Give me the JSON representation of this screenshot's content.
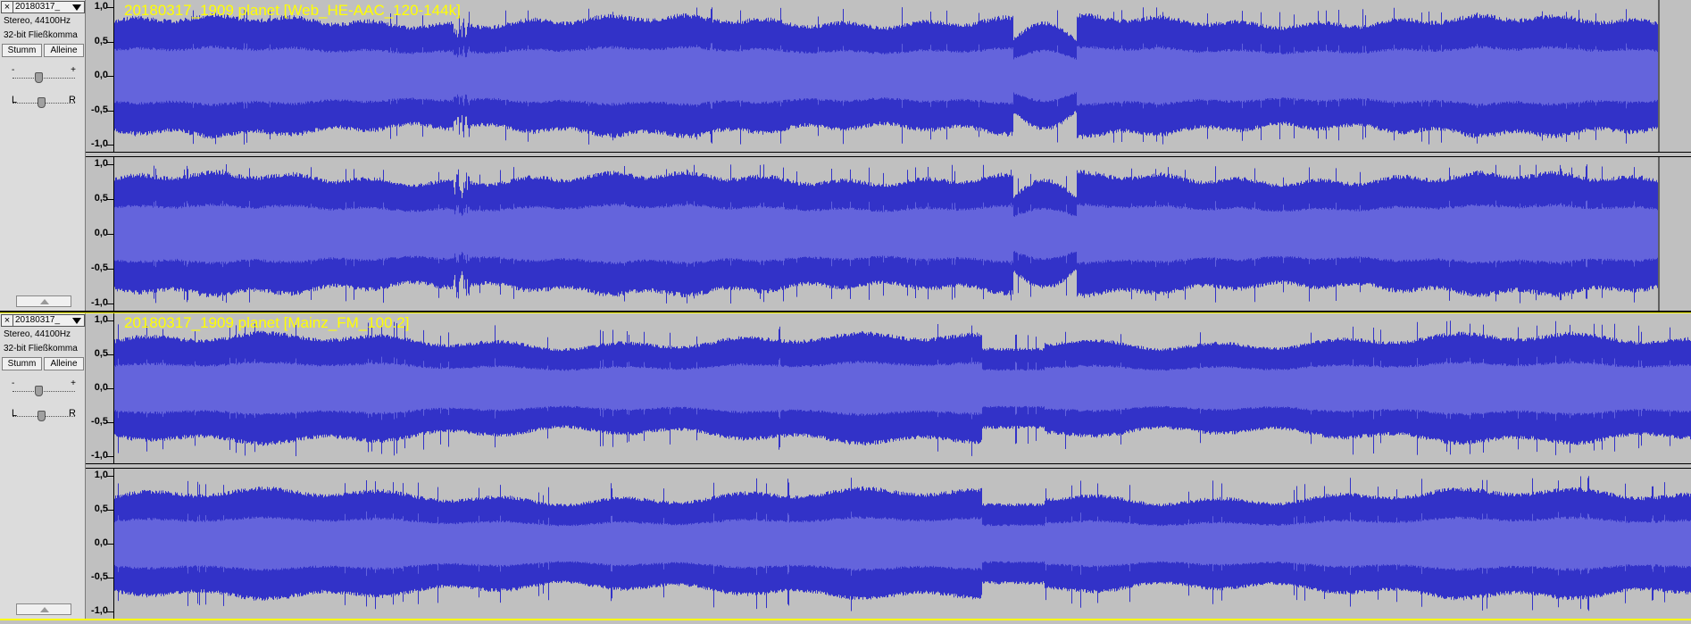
{
  "tracks": [
    {
      "id": "t1",
      "name_short": "20180317_",
      "title": "20180317_1909 planet [Web_HE-AAC_120-144k]",
      "rate": "Stereo, 44100Hz",
      "format": "32-bit Fließkomma",
      "mute_label": "Stumm",
      "solo_label": "Alleine",
      "gain_minus": "-",
      "gain_plus": "+",
      "pan_left": "L",
      "pan_right": "R",
      "scale_labels": [
        "1,0",
        "0,5",
        "0,0",
        "-0,5",
        "-1,0"
      ],
      "audio_end_fraction": 0.9789
    },
    {
      "id": "t2",
      "name_short": "20180317_",
      "title": "20180317_1909 planet [Mainz_FM_100.2]",
      "rate": "Stereo, 44100Hz",
      "format": "32-bit Fließkomma",
      "mute_label": "Stumm",
      "solo_label": "Alleine",
      "gain_minus": "-",
      "gain_plus": "+",
      "pan_left": "L",
      "pan_right": "R",
      "scale_labels": [
        "1,0",
        "0,5",
        "0,0",
        "-0,5",
        "-1,0"
      ],
      "audio_end_fraction": 1.0
    }
  ],
  "colors": {
    "wave_peak": "#3232c8",
    "wave_rms": "#6464dc",
    "background": "#c0c0c0",
    "title_text": "#ffff00"
  },
  "icons": {
    "close": "close-icon",
    "menu": "chevron-down-icon",
    "collapse": "collapse-up-icon"
  }
}
